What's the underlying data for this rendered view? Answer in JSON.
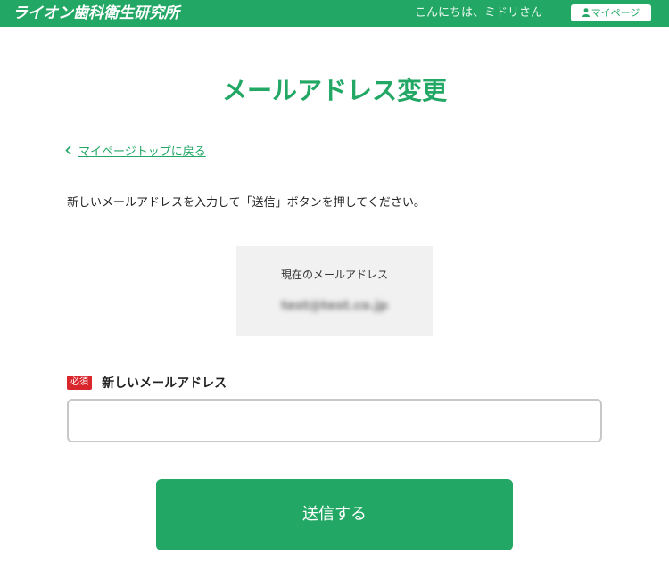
{
  "header": {
    "logo_text": "ライオン歯科衛生研究所",
    "greeting": "こんにちは、ミドリさん",
    "mypage_label": "マイページ"
  },
  "page": {
    "title": "メールアドレス変更",
    "back_link": "マイページトップに戻る",
    "instruction": "新しいメールアドレスを入力して「送信」ボタンを押してください。"
  },
  "current_email": {
    "label": "現在のメールアドレス",
    "value": "test@test.co.jp"
  },
  "new_email": {
    "required_badge": "必須",
    "label": "新しいメールアドレス",
    "value": "",
    "placeholder": ""
  },
  "submit": {
    "label": "送信する"
  },
  "colors": {
    "brand_green": "#22a765",
    "required_red": "#d9262c",
    "box_bg": "#f1f1f1"
  },
  "icons": [
    "user-icon",
    "chevron-left-icon"
  ]
}
